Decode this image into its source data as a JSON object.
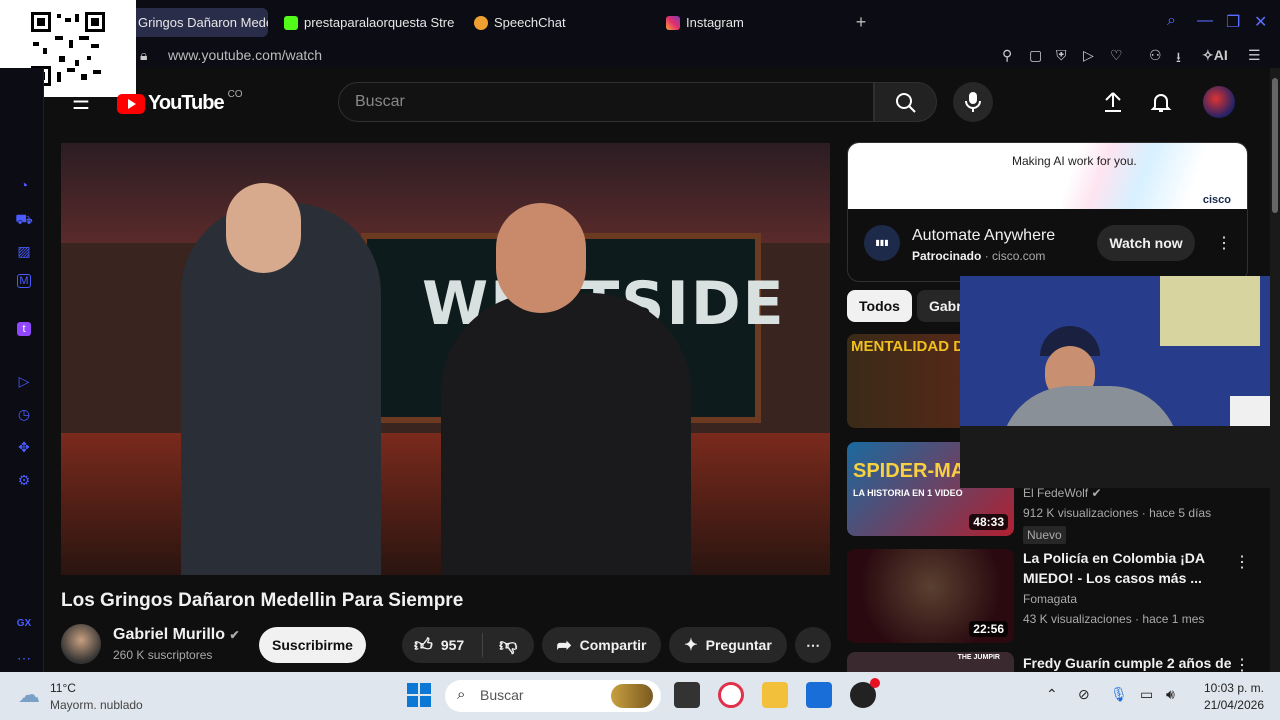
{
  "browser": {
    "tabs": [
      {
        "label": "Gringos Dañaron Mede",
        "active": true
      },
      {
        "label": "prestaparalaorquesta Stre"
      },
      {
        "label": "SpeechChat"
      },
      {
        "label": "Instagram"
      }
    ],
    "url": "www.youtube.com/watch",
    "ai_label": "AI"
  },
  "youtube": {
    "logo": "YouTube",
    "region": "CO",
    "search_placeholder": "Buscar",
    "video": {
      "overlay_sign": "WESTSIDE",
      "title": "Los Gringos Dañaron Medellin Para Siempre",
      "channel": "Gabriel Murillo",
      "subscribers": "260 K suscriptores",
      "subscribe_label": "Suscribirme",
      "likes": "957",
      "share_label": "Compartir",
      "ask_label": "Preguntar"
    },
    "ad": {
      "tagline": "Making AI work for you.",
      "brand": "cisco",
      "title": "Automate Anywhere",
      "sponsored": "Patrocinado",
      "domain": "cisco.com",
      "cta": "Watch now"
    },
    "chips": [
      "Todos",
      "Gabr"
    ],
    "recommendations": [
      {
        "thumb_text": "MENTALIDAD DE C",
        "duration": "",
        "title": "",
        "channel": "",
        "meta": "",
        "badge": ""
      },
      {
        "thumb_text": "SPIDER-MAN",
        "thumb_sub": "LA HISTORIA EN 1 VIDEO",
        "duration": "48:33",
        "title": "",
        "channel": "El FedeWolf",
        "meta": "912 K visualizaciones · hace 5 días",
        "badge": "Nuevo"
      },
      {
        "thumb_text": "",
        "duration": "22:56",
        "title": "La Policía en Colombia ¡DA MIEDO! - Los casos más ...",
        "channel": "Fomagata",
        "meta": "43 K visualizaciones · hace 1 mes",
        "badge": ""
      },
      {
        "thumb_text": "THE JUMPIR",
        "duration": "",
        "title": "Fredy Guarín cumple 2 años de",
        "channel": "",
        "meta": "",
        "badge": ""
      }
    ]
  },
  "taskbar": {
    "weather_temp": "11°C",
    "weather_desc": "Mayorm. nublado",
    "search_placeholder": "Buscar",
    "time": "10:03 p. m.",
    "date": "21/04/2026"
  },
  "colors": {
    "accent": "#5a6cff",
    "red": "#ff0000",
    "bg": "#0f0f0f"
  }
}
